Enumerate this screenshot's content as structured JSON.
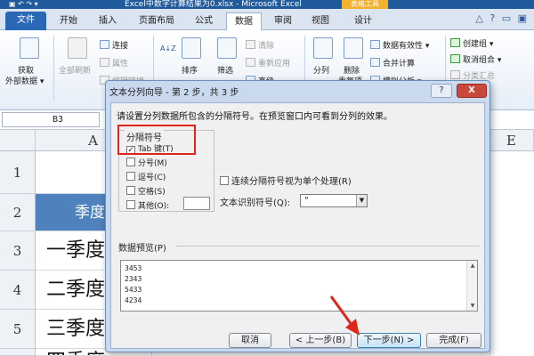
{
  "window": {
    "title": "Excel中数字计算结果为0.xlsx - Microsoft Excel",
    "context_tab": "表格工具",
    "quick_access": "▣ ↶ ↷ ▾"
  },
  "ribbon_tabs": [
    "文件",
    "开始",
    "插入",
    "页面布局",
    "公式",
    "数据",
    "审阅",
    "视图",
    "设计"
  ],
  "ribbon_help": "△ ? ▭ ▣",
  "ribbon": {
    "get_external": "获取",
    "get_external2": "外部数据 ▾",
    "refresh_all": "全部刷新",
    "connections": "连接",
    "properties": "属性",
    "edit_links": "编辑链接",
    "sort_az": "A↓Z",
    "sort": "排序",
    "filter": "筛选",
    "clear": "清除",
    "reapply": "重新应用",
    "advanced": "高级",
    "text_to_columns": "分列",
    "remove_dup": "删除",
    "remove_dup2": "重复项",
    "data_validation": "数据有效性 ▾",
    "consolidate": "合并计算",
    "what_if": "模拟分析 ▾",
    "group": "创建组 ▾",
    "ungroup": "取消组合 ▾",
    "subtotal": "分类汇总"
  },
  "name_box": "B3",
  "columns": [
    "A",
    "E"
  ],
  "rows": [
    "1",
    "2",
    "3",
    "4",
    "5"
  ],
  "cells": {
    "a2": "季度",
    "a3": "一季度",
    "a4": "二季度",
    "a5": "三季度",
    "a6": "四季度"
  },
  "dialog": {
    "title": "文本分列向导 - 第 2 步，共 3 步",
    "help_btn": "?",
    "close_btn": "X",
    "instruction": "请设置分列数据所包含的分隔符号。在预览窗口内可看到分列的效果。",
    "delimiters_title": "分隔符号",
    "delimiters": [
      {
        "label": "Tab 键(T)",
        "checked": true
      },
      {
        "label": "分号(M)",
        "checked": false
      },
      {
        "label": "逗号(C)",
        "checked": false
      },
      {
        "label": "空格(S)",
        "checked": false
      },
      {
        "label": "其他(O):",
        "checked": false
      }
    ],
    "other_value": "",
    "consecutive_label": "连续分隔符号视为单个处理(R)",
    "qualifier_label": "文本识别符号(Q):",
    "qualifier_value": "\"",
    "preview_title": "数据预览(P)",
    "preview_rows": [
      "3453",
      "2343",
      "5433",
      "4234"
    ],
    "buttons": {
      "cancel": "取消",
      "back": "< 上一步(B)",
      "next": "下一步(N) >",
      "finish": "完成(F)"
    }
  },
  "colors": {
    "title_bar": "#1e5a9c",
    "header_fill": "#4f81bd",
    "highlight": "#e0261c",
    "context_tab": "#f2b12e"
  }
}
